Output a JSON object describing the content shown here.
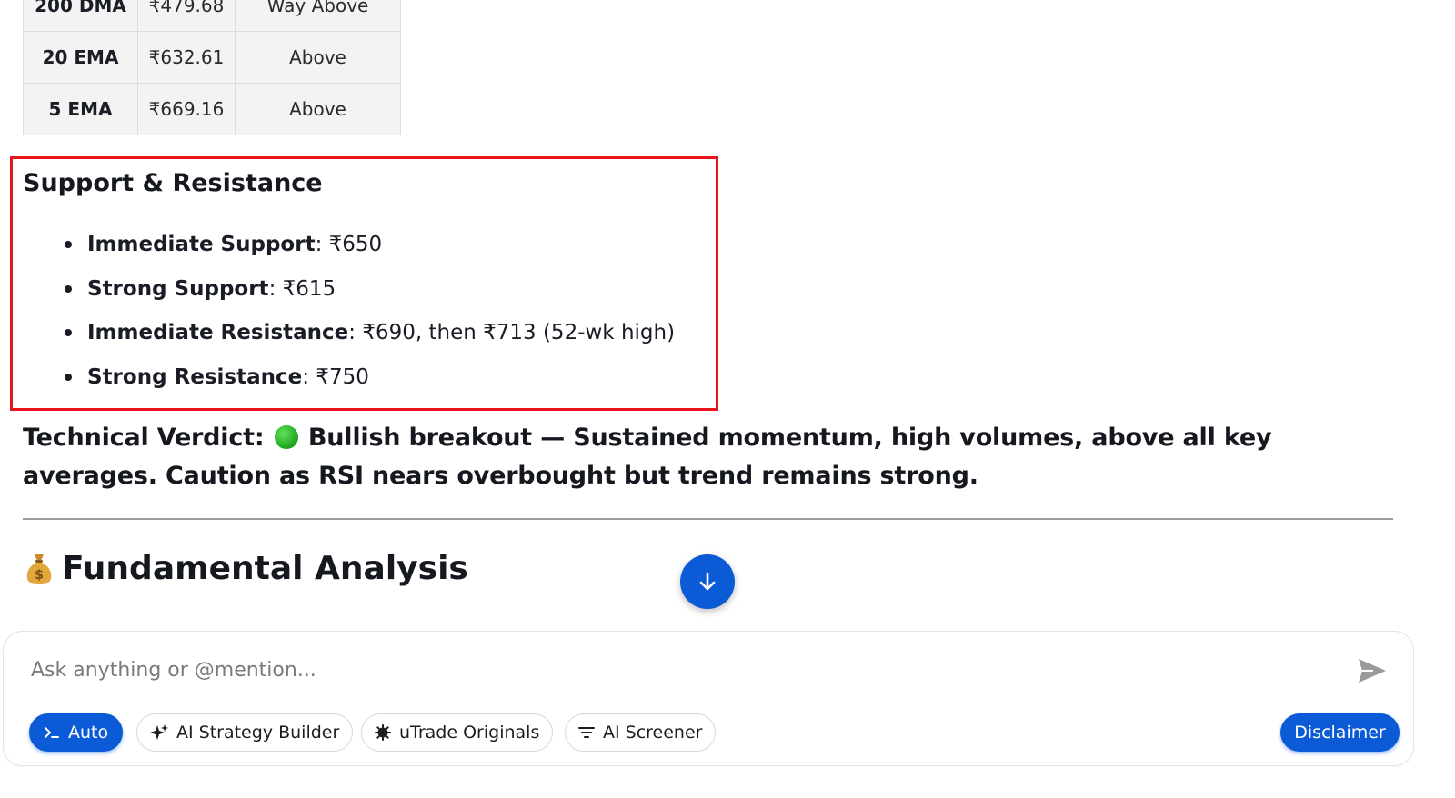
{
  "ma_table": {
    "rows": [
      {
        "label": "200 DMA",
        "value": "₹479.68",
        "status": "Way Above"
      },
      {
        "label": "20 EMA",
        "value": "₹632.61",
        "status": "Above"
      },
      {
        "label": "5 EMA",
        "value": "₹669.16",
        "status": "Above"
      }
    ]
  },
  "support_resistance": {
    "title": "Support & Resistance",
    "items": [
      {
        "label": "Immediate Support",
        "value": ": ₹650"
      },
      {
        "label": "Strong Support",
        "value": ": ₹615"
      },
      {
        "label": "Immediate Resistance",
        "value": ": ₹690, then ₹713 (52-wk high)"
      },
      {
        "label": "Strong Resistance",
        "value": ": ₹750"
      }
    ]
  },
  "verdict": {
    "label": "Technical Verdict:",
    "emoji": "green-circle",
    "headline": "Bullish breakout",
    "text": " — Sustained momentum, high volumes, above all key averages. Caution as RSI nears overbought but trend remains strong."
  },
  "fundamental": {
    "icon": "money-bag-icon",
    "title": "Fundamental Analysis"
  },
  "chat": {
    "placeholder": "Ask anything or @mention...",
    "chips": {
      "auto": "Auto",
      "strategy": "AI Strategy Builder",
      "originals": "uTrade Originals",
      "screener": "AI Screener"
    },
    "disclaimer": "Disclaimer"
  },
  "colors": {
    "accent": "#0b5ad6",
    "highlight_border": "#e8141c",
    "text": "#1a1c26"
  }
}
